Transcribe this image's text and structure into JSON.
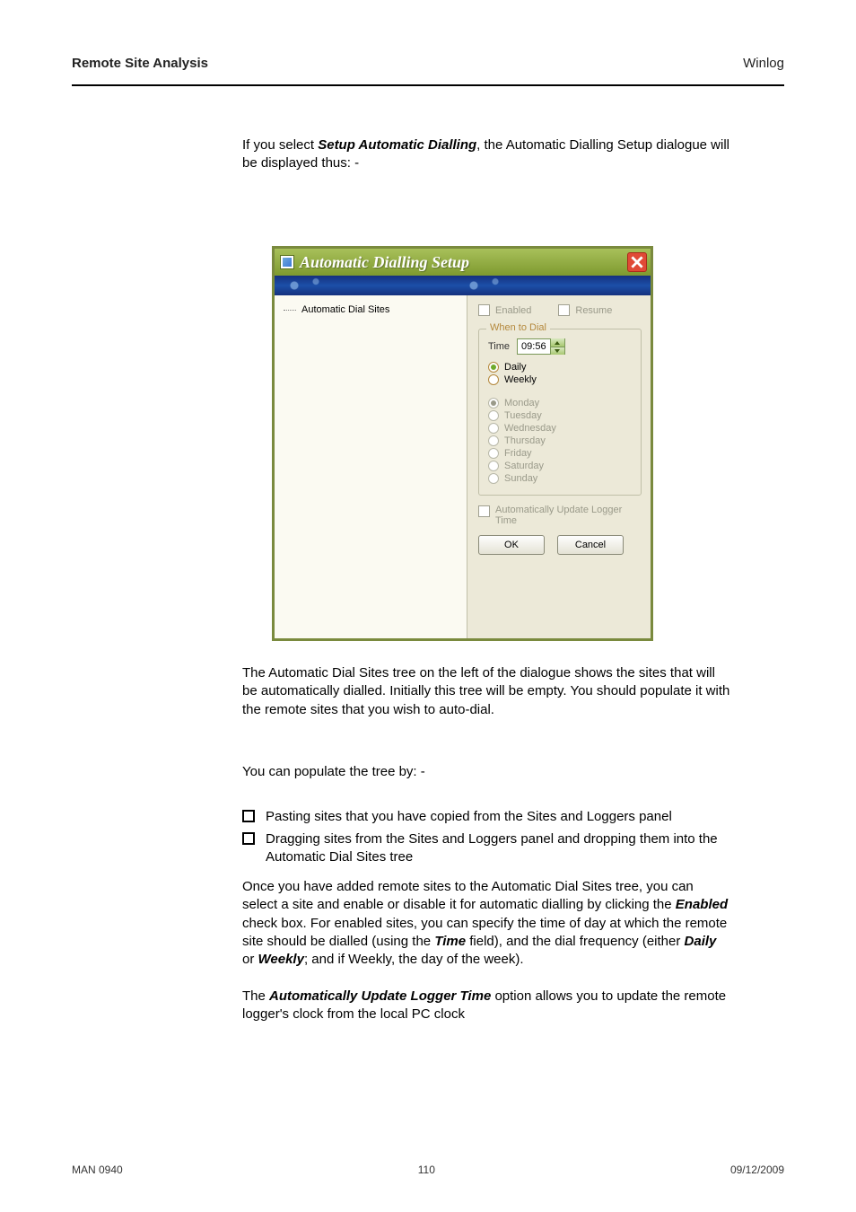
{
  "header": {
    "left": "Remote Site Analysis",
    "right": "Winlog"
  },
  "para": {
    "intro1": "If you select ",
    "intro_em": "Setup Automatic Dialling",
    "intro2": ", the Automatic Dialling Setup dialogue will be displayed thus: -",
    "sites_text": "The Automatic Dial Sites tree on the left of the dialogue shows the sites that will be automatically dialled. Initially this tree will be empty. You should populate it with the remote sites that you wish to auto-dial.",
    "pop1": "You can populate the tree by: -",
    "bullet1": "Pasting sites that you have copied from the Sites and Loggers panel",
    "bullet2": "Dragging sites from the Sites and Loggers panel and dropping them into the Automatic Dial Sites tree",
    "enable1": "Once you have added remote sites to the Automatic Dial Sites tree, you can select a site and enable or disable it for automatic dialling by clicking the ",
    "enable_em1": "Enabled",
    "enable2": " check box. For enabled sites, you can specify the time of day at which the remote site should be dialled (using the ",
    "enable_em2": "Time",
    "enable3": " field), and the dial frequency (either ",
    "enable_em3": "Daily ",
    "enable4": "or ",
    "enable_em4": "Weekly",
    "enable5": "; and if Weekly, the day of the week).",
    "logger1": "The ",
    "logger_em": "Automatically Update Logger Time",
    "logger2": " option allows you to update the remote logger's clock from the local PC clock"
  },
  "footer": {
    "left": "MAN 0940",
    "center": "110",
    "right": "09/12/2009"
  },
  "dialog": {
    "title": "Automatic Dialling Setup",
    "tree_root": "Automatic Dial Sites",
    "enabled_label": "Enabled",
    "resume_label": "Resume",
    "when_to_dial": "When to Dial",
    "time_label": "Time",
    "time_value": "09:56",
    "daily": "Daily",
    "weekly": "Weekly",
    "days": {
      "mon": "Monday",
      "tue": "Tuesday",
      "wed": "Wednesday",
      "thu": "Thursday",
      "fri": "Friday",
      "sat": "Saturday",
      "sun": "Sunday"
    },
    "auto_update": "Automatically Update Logger Time",
    "ok": "OK",
    "cancel": "Cancel"
  }
}
